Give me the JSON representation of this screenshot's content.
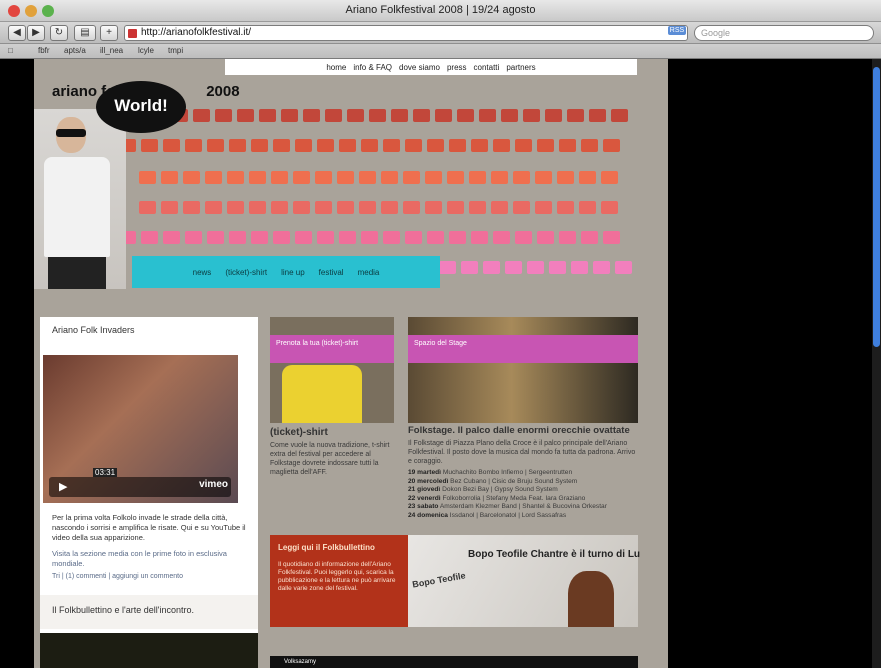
{
  "window": {
    "title": "Ariano Folkfestival 2008 | 19/24 agosto"
  },
  "toolbar": {
    "url": "http://arianofolkfestival.it/",
    "rss": "RSS",
    "search_placeholder": "Google"
  },
  "bookmarks": [
    "",
    "fbfr",
    "apts/a",
    "ill_nea",
    "lcyle",
    "tmpi"
  ],
  "site": {
    "title_left": "ariano folk",
    "title_right": "2008",
    "bubble": "World!",
    "topnav": [
      "home",
      "info & FAQ",
      "dove siamo",
      "press",
      "contatti",
      "partners"
    ],
    "menu": [
      "news",
      "(ticket)-shirt",
      "line up",
      "festival",
      "media"
    ]
  },
  "left": {
    "section_title": "Ariano Folk Invaders",
    "video_time": "03:31",
    "video_logo": "vimeo",
    "text": "Per la prima volta Folkolo invade le strade della città, nascondo i sorrisi e amplifica le risate. Qui e su YouTube il video della sua apparizione.",
    "text2": "Visita la sezione media con le prime foto in esclusiva mondiale.",
    "meta": "Tri | (1) commenti | aggiungi un commento",
    "section2": "Il Folkbullettino e l'arte dell'incontro."
  },
  "card1": {
    "band": "Prenota la tua (ticket)-shirt",
    "title": "(ticket)-shirt",
    "body": "Come vuole la nuova tradizione, t-shirt extra del festival per accedere al Folkstage dovrete indossare tutti la maglietta dell'AFF."
  },
  "card2": {
    "band": "Spazio del Stage",
    "title": "Folkstage. Il palco dalle enormi orecchie ovattate",
    "body": "Il Folkstage di Piazza Plano della Croce è il palco principale dell'Ariano Folkfestival. Il posto dove la musica dal mondo fa tutta da padrona. Arrivo e coraggio."
  },
  "program": [
    {
      "day": "19 martedì",
      "acts": "Muchachito Bombo Infierno | Sergeentrutten"
    },
    {
      "day": "20 mercoledì",
      "acts": "Bez Cubano | Cisic de Bruju Sound System"
    },
    {
      "day": "21 giovedì",
      "acts": "Dokon Bezi Bay | Gypsy Sound System"
    },
    {
      "day": "22 venerdì",
      "acts": "Folkoborrolia | Stefany Meda Feat. Iara Graziano"
    },
    {
      "day": "23 sabato",
      "acts": "Amsterdam Klezmer Band | Shantel & Bucovina Orkestar"
    },
    {
      "day": "24 domenica",
      "acts": "Issdanol | Barcelonatol | Lord Sassafras"
    }
  ],
  "red_box": {
    "title": "Leggi qui il Folkbullettino",
    "body": "Il quotidiano di informazione dell'Ariano Folkfestival. Puoi leggerlo qui, scarica la pubblicazione e la lettura ne può arrivare dalle varie zone del festival."
  },
  "newspaper": {
    "headline": "Bopo Teofile Chantre è il turno di Lu",
    "headline2": "Bopo Teofile"
  },
  "bottom": "Volksazamy",
  "colors": {
    "accent_pink": "#c855b3",
    "menu_cyan": "#29c0d0",
    "red_box": "#b2321a",
    "page_bg": "#a9a39a"
  }
}
